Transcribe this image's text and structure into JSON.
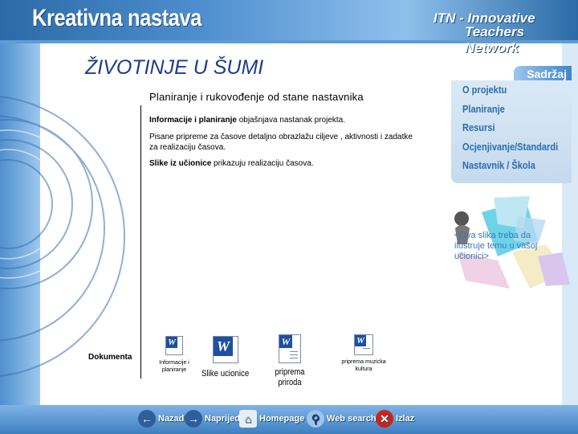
{
  "header": {
    "site_title": "Kreativna nastava",
    "network_line1": "ITN - Innovative",
    "network_line2": "Teachers Network"
  },
  "main": {
    "page_title": "ŽIVOTINJE U ŠUMI",
    "section_title": "Planiranje i rukovođenje od stane nastavnika",
    "para1_bold": "Informacije i planiranje",
    "para1_rest": " objašnjava nastanak projekta.",
    "para2": "Pisane pripreme za časove detaljno obrazlažu ciljeve , aktivnosti i zadatke za realizaciju časova.",
    "para3_bold": "Slike iz učionice",
    "para3_rest": " prikazuju realizaciju časova.",
    "documents_label": "Dokumenta",
    "documents": [
      {
        "label": "Informacije i planiranje",
        "icon": "word-document-icon"
      },
      {
        "label": "Slike ucionice",
        "icon": "word-document-icon"
      },
      {
        "label": "priprema priroda",
        "icon": "word-document-icon"
      },
      {
        "label": "priprema muzicka kultura",
        "icon": "word-document-icon"
      }
    ]
  },
  "sidebar": {
    "tab_label": "Sadržaj",
    "items": [
      {
        "label": "O projektu"
      },
      {
        "label": "Planiranje"
      },
      {
        "label": "Resursi"
      },
      {
        "label": "Ocjenjivanje/Standardi"
      },
      {
        "label": "Nastavnik / Škola"
      }
    ],
    "image_note": "<Ova slika treba da ilustruje temu u vašoj učionici>"
  },
  "footer_nav": [
    {
      "label": "Nazad",
      "icon": "arrow-left-icon"
    },
    {
      "label": "Naprijed",
      "icon": "arrow-right-icon"
    },
    {
      "label": "Homepage",
      "icon": "home-icon"
    },
    {
      "label": "Web search",
      "icon": "magnifier-icon"
    },
    {
      "label": "Izlaz",
      "icon": "close-icon"
    }
  ],
  "colors": {
    "brand_blue": "#2b6aa6",
    "menu_text": "#2a6cb0",
    "title_text": "#1f3a8a"
  }
}
